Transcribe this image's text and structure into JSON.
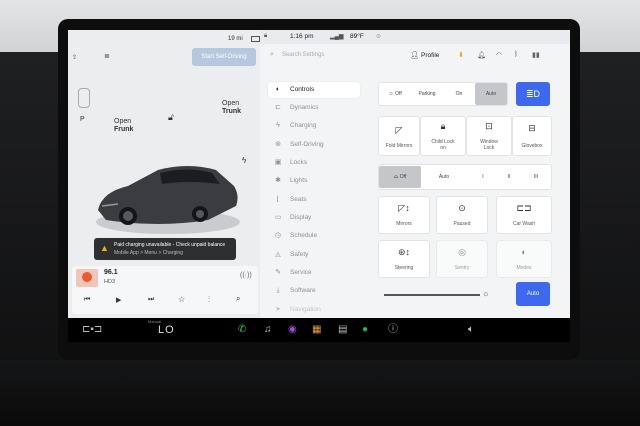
{
  "status": {
    "range": "19 mi",
    "time": "1:16 pm",
    "temperature": "89°F"
  },
  "left": {
    "self_driving_button": "Start Self-Driving",
    "frunk": {
      "line1": "Open",
      "line2": "Frunk"
    },
    "trunk": {
      "line1": "Open",
      "line2": "Trunk"
    },
    "gear": "P",
    "alert": {
      "title": "Paid charging unavailable - Check unpaid balance",
      "sub": "Mobile App > Menu > Charging"
    },
    "media": {
      "station": "96.1",
      "band": "HD3"
    }
  },
  "search": {
    "placeholder": "Search Settings"
  },
  "profile": {
    "label": "Profile"
  },
  "menu": [
    {
      "label": "Controls",
      "icon": "toggle-icon"
    },
    {
      "label": "Dynamics",
      "icon": "car-icon"
    },
    {
      "label": "Charging",
      "icon": "bolt-icon"
    },
    {
      "label": "Self-Driving",
      "icon": "steering-icon"
    },
    {
      "label": "Locks",
      "icon": "lock-icon"
    },
    {
      "label": "Lights",
      "icon": "bulb-icon"
    },
    {
      "label": "Seats",
      "icon": "seat-icon"
    },
    {
      "label": "Display",
      "icon": "display-icon"
    },
    {
      "label": "Schedule",
      "icon": "clock-icon"
    },
    {
      "label": "Safety",
      "icon": "warning-icon"
    },
    {
      "label": "Service",
      "icon": "wrench-icon"
    },
    {
      "label": "Software",
      "icon": "download-icon"
    },
    {
      "label": "Navigation",
      "icon": "navigation-icon"
    }
  ],
  "controls": {
    "headlights": [
      "Off",
      "Parking",
      "On",
      "Auto"
    ],
    "row2": [
      "Fold Mirrors",
      "Child Lock",
      "Window Lock",
      "Glovebox"
    ],
    "child_lock_sub": "on",
    "wipers": [
      "Off",
      "Auto",
      "I",
      "II",
      "III"
    ],
    "row4": [
      "Mirrors",
      "Paused",
      "Car Wash"
    ],
    "row5": [
      "Steering",
      "Sentry",
      "Modes"
    ],
    "brightness_auto": "Auto"
  },
  "bottom": {
    "climate_top": "Manual",
    "climate_value": "LO"
  }
}
